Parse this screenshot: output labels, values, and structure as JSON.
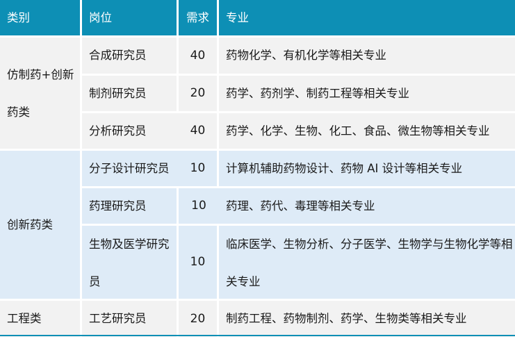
{
  "header": {
    "category": "类别",
    "position": "岗位",
    "demand": "需求",
    "major": "专业"
  },
  "groups": [
    {
      "category": "仿制药+创新药类",
      "rows": [
        {
          "position": "合成研究员",
          "demand": "40",
          "major": "药物化学、有机化学等相关专业"
        },
        {
          "position": "制剂研究员",
          "demand": "20",
          "major": "药学、药剂学、制药工程等相关专业"
        },
        {
          "position": "分析研究员",
          "demand": "40",
          "major": "药学、化学、生物、化工、食品、微生物等相关专业"
        }
      ]
    },
    {
      "category": "创新药类",
      "rows": [
        {
          "position": "分子设计研究员",
          "demand": "10",
          "major": "计算机辅助药物设计、药物 AI 设计等相关专业"
        },
        {
          "position": "药理研究员",
          "demand": "10",
          "major": "药理、药代、毒理等相关专业"
        },
        {
          "position": "生物及医学研究员",
          "demand": "10",
          "major": "临床医学、生物分析、分子医学、生物学与生物化学等相关专业"
        }
      ]
    },
    {
      "category": "工程类",
      "rows": [
        {
          "position": "工艺研究员",
          "demand": "20",
          "major": "制药工程、药物制剂、药学、生物类等相关专业"
        }
      ]
    }
  ],
  "colors": {
    "header_bg": "#0d8fb5",
    "group_gray": "#f2f2f2",
    "group_blue": "#deebf7"
  }
}
